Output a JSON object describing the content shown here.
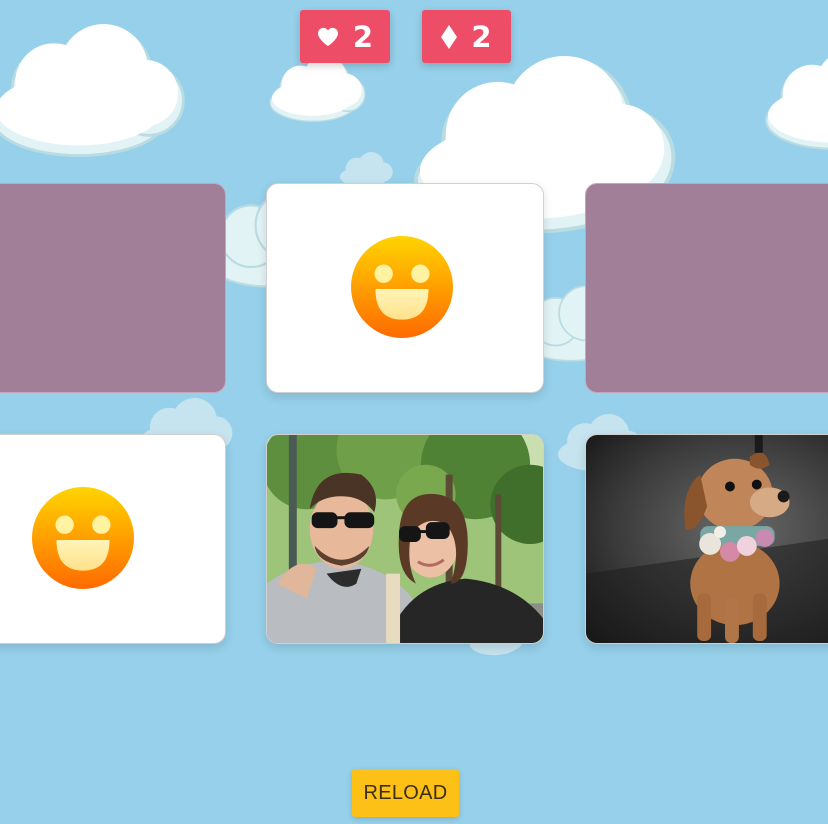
{
  "hud": {
    "lives": {
      "icon": "heart-icon",
      "value": "2"
    },
    "gems": {
      "icon": "diamond-icon",
      "value": "2"
    }
  },
  "cards": [
    {
      "state": "face-down",
      "content": ""
    },
    {
      "state": "face-up",
      "content": "smiley-icon"
    },
    {
      "state": "face-down",
      "content": ""
    },
    {
      "state": "face-up",
      "content": "smiley-icon"
    },
    {
      "state": "face-up",
      "content": "couple-selfie-photo"
    },
    {
      "state": "face-up",
      "content": "dog-photo"
    }
  ],
  "controls": {
    "reload_label": "RELOAD"
  },
  "colors": {
    "sky": "#96d0ea",
    "badge": "#ee4d67",
    "card_back": "#a27f98",
    "card_face": "#ffffff",
    "reload": "#fcc017"
  }
}
